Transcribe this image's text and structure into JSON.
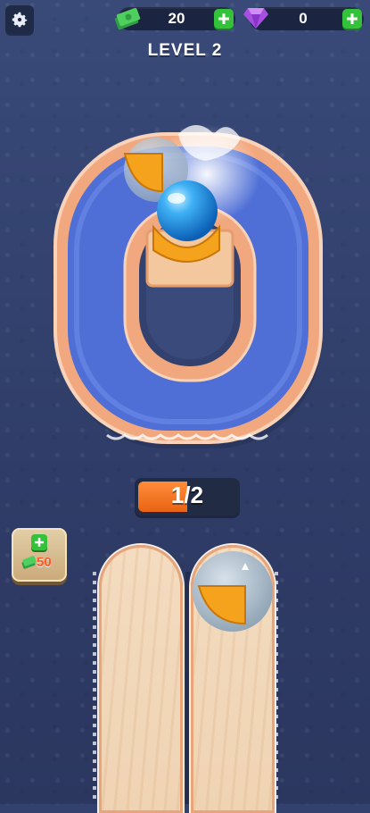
{
  "hud": {
    "cash_value": "20",
    "gems_value": "0",
    "icons": {
      "settings": "gear-icon",
      "cash": "cash-stack-icon",
      "gems": "purple-gem-icon",
      "add": "plus-icon"
    }
  },
  "level": {
    "title": "LEVEL 2"
  },
  "progress": {
    "text": "1/2",
    "fraction": 0.5
  },
  "shop": {
    "price": "50",
    "icons": {
      "add": "plus-icon",
      "cash": "cash-stack-icon"
    }
  },
  "colors": {
    "accent_green": "#33c23a",
    "progress_orange": "#f07625",
    "track_rim": "#f2a87f",
    "water": "#4f6fd6",
    "ball_blue": "#1e8fe6",
    "wedge_orange": "#f5a21c"
  }
}
